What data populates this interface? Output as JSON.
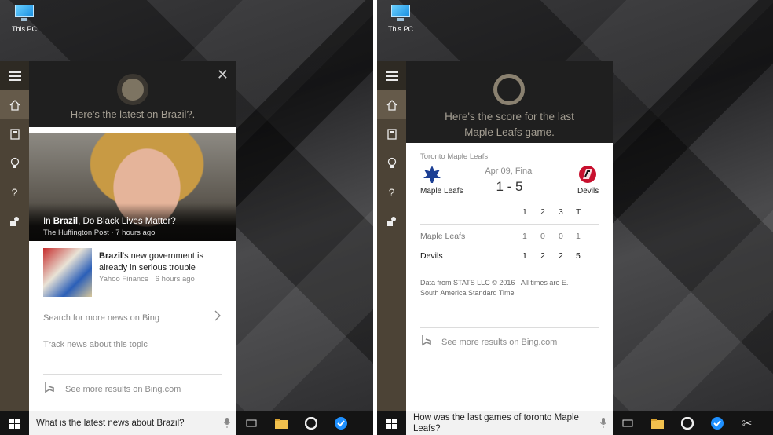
{
  "desktop_icon": {
    "label": "This PC"
  },
  "left": {
    "cortana": {
      "prompt": "Here's the latest on Brazil?."
    },
    "hero": {
      "pre": "In ",
      "bold": "Brazil",
      "post": ", Do Black Lives Matter?",
      "source": "The Huffington Post · 7 hours ago"
    },
    "story": {
      "bold": "Brazil",
      "rest_line1": "'s new government is",
      "line2": "already in serious trouble",
      "source": "Yahoo Finance · 6 hours ago"
    },
    "links": {
      "search_more": "Search for more news on Bing",
      "track": "Track news about this topic"
    },
    "see_more": "See more results on Bing.com",
    "query": "What is the latest news about Brazil?"
  },
  "right": {
    "cortana": {
      "prompt_line1": "Here's the score for the last",
      "prompt_line2": "Maple Leafs game."
    },
    "card": {
      "header": "Toronto Maple Leafs",
      "date": "Apr 09, Final",
      "score": "1 - 5",
      "home": "Maple Leafs",
      "away": "Devils",
      "periods": [
        "1",
        "2",
        "3",
        "T"
      ],
      "rows": [
        {
          "team": "Maple Leafs",
          "values": [
            "1",
            "0",
            "0",
            "1"
          ]
        },
        {
          "team": "Devils",
          "values": [
            "1",
            "2",
            "2",
            "5"
          ]
        }
      ],
      "footnote_line1": "Data from STATS LLC © 2016 · All times are E.",
      "footnote_line2": "South America Standard Time"
    },
    "see_more": "See more results on Bing.com",
    "query_line1": "How was the last games of toronto Maple",
    "query_line2": "Leafs?"
  },
  "colors": {
    "rail": "#4c4336",
    "rail_active": "#655a4a",
    "cortana_bg": "#1f1f1f",
    "accent_blue": "#1e90ff"
  },
  "icons": [
    "hamburger-icon",
    "home-icon",
    "notebook-icon",
    "lightbulb-icon",
    "help-icon",
    "feedback-icon",
    "close-icon",
    "microphone-icon",
    "bing-icon",
    "chevron-right-icon",
    "windows-logo-icon",
    "task-view-icon",
    "file-explorer-icon",
    "opera-icon",
    "browser-icon",
    "scissors-icon"
  ]
}
